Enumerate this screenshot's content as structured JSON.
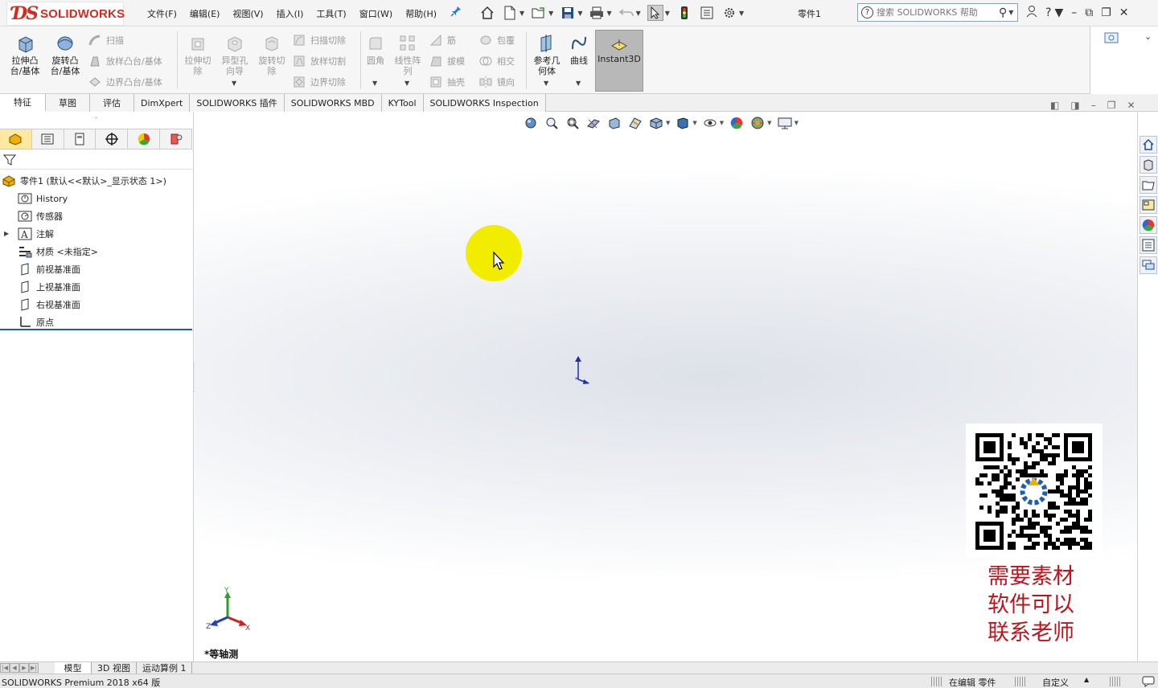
{
  "app": {
    "brand": "SOLIDWORKS",
    "document_title": "零件1"
  },
  "menu": [
    "文件(F)",
    "编辑(E)",
    "视图(V)",
    "插入(I)",
    "工具(T)",
    "窗口(W)",
    "帮助(H)"
  ],
  "search": {
    "placeholder": "搜索 SOLIDWORKS 帮助"
  },
  "features_toolbar": {
    "extrude_boss": "拉伸凸\n台/基体",
    "revolve_boss": "旋转凸\n台/基体",
    "sweep": "扫描",
    "loft_boss": "放样凸台/基体",
    "boundary_boss": "边界凸台/基体",
    "extrude_cut": "拉伸切\n除",
    "hole_wizard": "异型孔\n向导",
    "revolve_cut": "旋转切\n除",
    "swept_cut": "扫描切除",
    "lofted_cut": "放样切割",
    "boundary_cut": "边界切除",
    "fillet": "圆角",
    "linear_pattern": "线性阵\n列",
    "rib": "筋",
    "draft": "拔模",
    "shell": "抽壳",
    "wrap": "包覆",
    "intersect": "相交",
    "mirror": "镜向",
    "reference_geometry": "参考几\n何体",
    "curves": "曲线",
    "instant3d": "Instant3D"
  },
  "tabs": [
    "特征",
    "草图",
    "评估",
    "DimXpert",
    "SOLIDWORKS 插件",
    "SOLIDWORKS MBD",
    "KYTool",
    "SOLIDWORKS Inspection"
  ],
  "feature_tree": {
    "root": "零件1 (默认<<默认>_显示状态 1>)",
    "items": [
      {
        "label": "History",
        "icon": "history-icon"
      },
      {
        "label": "传感器",
        "icon": "sensor-icon"
      },
      {
        "label": "注解",
        "icon": "annotation-icon"
      },
      {
        "label": "材质 <未指定>",
        "icon": "material-icon"
      },
      {
        "label": "前视基准面",
        "icon": "plane-icon"
      },
      {
        "label": "上视基准面",
        "icon": "plane-icon"
      },
      {
        "label": "右视基准面",
        "icon": "plane-icon"
      },
      {
        "label": "原点",
        "icon": "origin-icon"
      }
    ]
  },
  "viewport": {
    "view_name": "*等轴测",
    "triad": {
      "x": "X",
      "y": "Y",
      "z": "Z"
    }
  },
  "overlay": {
    "lines": [
      "需要素材",
      "软件可以",
      "联系老师"
    ]
  },
  "bottom_tabs": [
    "模型",
    "3D 视图",
    "运动算例 1"
  ],
  "status": {
    "product": "SOLIDWORKS Premium 2018 x64 版",
    "mode": "在编辑 零件",
    "units": "自定义"
  },
  "colors": {
    "brand_red": "#d52b1e",
    "cursor_highlight": "#f2ec00",
    "overlay_text": "#c0141c"
  }
}
